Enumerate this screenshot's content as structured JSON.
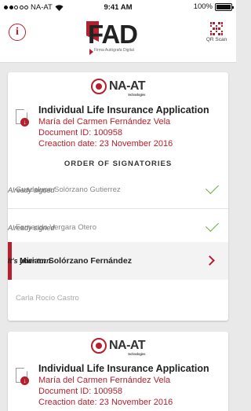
{
  "status_bar": {
    "carrier": "NA-AT",
    "time": "9:41 AM",
    "battery": "100%"
  },
  "header": {
    "logo_text": "FAD",
    "logo_tagline": "Firma Autógrafa Digital",
    "qr_label": "QR Scan"
  },
  "documents": [
    {
      "company": "NA-AT",
      "company_sub": "technologies",
      "title": "Individual Life Insurance Application",
      "owner": "María del Carmen Fernández Vela",
      "doc_id": "Document ID: 100958",
      "creation_date": "Creaction date: 23 November 2016",
      "order_title": "ORDER OF SIGNATORIES",
      "signatories": [
        {
          "name": "Guadalupe Solórzano Gutierrez",
          "status": "Already signed",
          "state": "signed"
        },
        {
          "name": "Fernando Vergara Otero",
          "status": "Already signed",
          "state": "signed"
        },
        {
          "name": "Miriam Solórzano Fernández",
          "status": "It's your turn",
          "state": "current"
        },
        {
          "name": "Carla Rocío Castro",
          "status": "",
          "state": "pending"
        }
      ]
    },
    {
      "company": "NA-AT",
      "company_sub": "technologies",
      "title": "Individual Life Insurance Application",
      "owner": "María del Carmen Fernández Vela",
      "doc_id": "Document ID: 100958",
      "creation_date": "Creaction date: 23 November 2016"
    }
  ],
  "colors": {
    "accent": "#b5202e",
    "signed": "#6ab04c",
    "background": "#e9e9ea"
  }
}
